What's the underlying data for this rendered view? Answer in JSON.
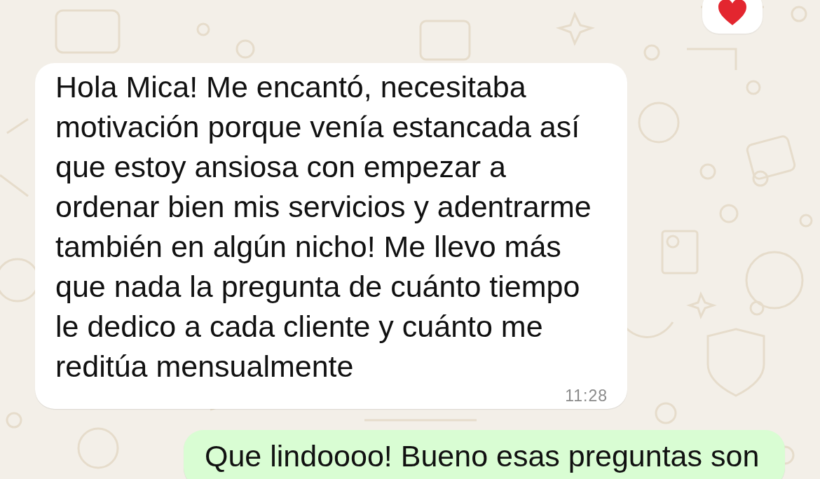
{
  "reaction": {
    "kind": "heart"
  },
  "messages": [
    {
      "kind": "incoming",
      "text": "Hola Mica! Me encantó, necesitaba motivación porque venía estancada así que estoy ansiosa con empezar a ordenar bien mis servicios y adentrarme también en algún nicho! Me llevo más que nada la pregunta de cuánto tiempo le dedico a cada cliente y cuánto me reditúa mensualmente",
      "time": "11:28"
    },
    {
      "kind": "outgoing",
      "text": "Que lindoooo! Bueno esas preguntas son"
    }
  ]
}
